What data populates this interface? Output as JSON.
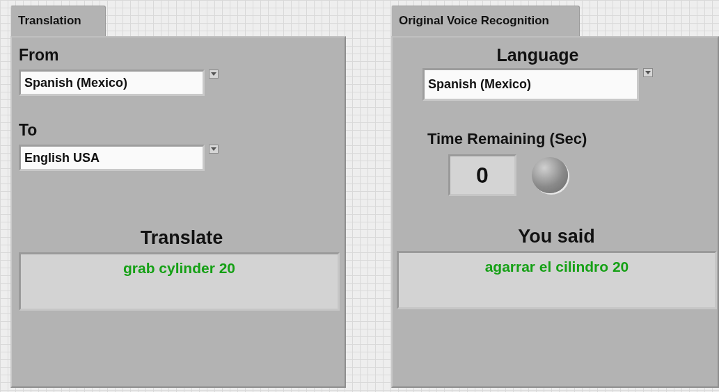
{
  "translation_panel": {
    "tab": {
      "label": "Translation",
      "selected": true
    },
    "from": {
      "label": "From",
      "value": "Spanish (Mexico)"
    },
    "to": {
      "label": "To",
      "value": "English USA"
    },
    "output": {
      "label": "Translate",
      "value": "grab cylinder 20"
    }
  },
  "recognition_panel": {
    "tab": {
      "label": "Original Voice Recognition",
      "selected": true
    },
    "language": {
      "label": "Language",
      "value": "Spanish (Mexico)"
    },
    "time_remaining": {
      "label": "Time Remaining (Sec)",
      "value": "0"
    },
    "indicator": {
      "on": false
    },
    "output": {
      "label": "You said",
      "value": "agarrar el cilindro 20"
    }
  }
}
